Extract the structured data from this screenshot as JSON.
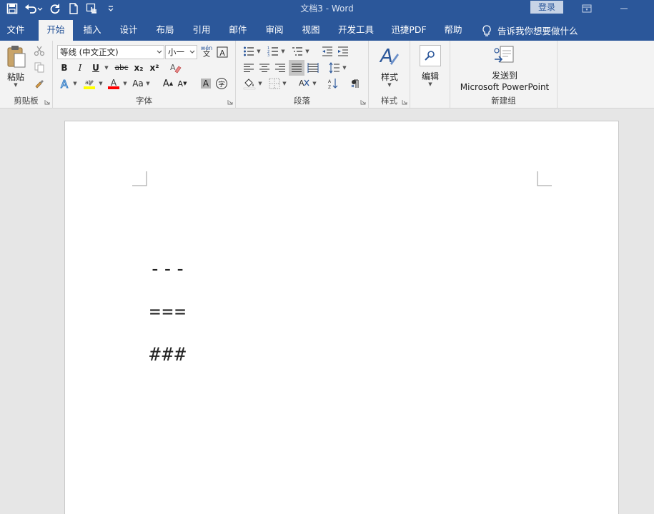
{
  "window": {
    "title": "文档3  -  Word",
    "login_label": "登录"
  },
  "tabs": [
    {
      "label": "文件"
    },
    {
      "label": "开始"
    },
    {
      "label": "插入"
    },
    {
      "label": "设计"
    },
    {
      "label": "布局"
    },
    {
      "label": "引用"
    },
    {
      "label": "邮件"
    },
    {
      "label": "审阅"
    },
    {
      "label": "视图"
    },
    {
      "label": "开发工具"
    },
    {
      "label": "迅捷PDF"
    },
    {
      "label": "帮助"
    }
  ],
  "tellme": "告诉我你想要做什么",
  "ribbon": {
    "clipboard": {
      "paste_label": "粘贴",
      "group_label": "剪贴板"
    },
    "font": {
      "font_name": "等线 (中文正文)",
      "font_size": "小一",
      "phonetic_glyph": "wén",
      "bold": "B",
      "italic": "I",
      "underline": "U",
      "strike": "abc",
      "subscript": "x₂",
      "superscript": "x²",
      "change_case": "Aa",
      "grow": "A",
      "shrink": "A",
      "shade_char": "A",
      "enclose_char": "字",
      "group_label": "字体"
    },
    "paragraph": {
      "group_label": "段落"
    },
    "styles": {
      "label": "样式",
      "group_label": "样式"
    },
    "editing": {
      "label": "编辑"
    },
    "newgroup": {
      "send_line1": "发送到",
      "send_line2": "Microsoft PowerPoint",
      "group_label": "新建组"
    }
  },
  "document": {
    "lines": [
      "---",
      "===",
      "###"
    ]
  },
  "colors": {
    "accent": "#2b579a",
    "highlight": "#ffff00",
    "font_color": "#ff0000"
  }
}
